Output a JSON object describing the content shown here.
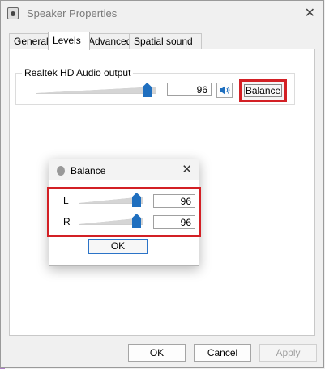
{
  "window": {
    "title": "Speaker Properties",
    "close_glyph": "✕"
  },
  "tabs": [
    {
      "label": "General",
      "active": false
    },
    {
      "label": "Levels",
      "active": true
    },
    {
      "label": "Advanced",
      "active": false
    },
    {
      "label": "Spatial sound",
      "active": false
    }
  ],
  "levels": {
    "group_label": "Realtek HD Audio output",
    "volume_value": "96",
    "volume_level": 0.96,
    "speaker_icon": "speaker-icon",
    "balance_label": "Balance"
  },
  "balance_dialog": {
    "title": "Balance",
    "icon": "speaker-icon",
    "close_glyph": "✕",
    "channels": [
      {
        "label": "L",
        "value": "96",
        "level": 0.96
      },
      {
        "label": "R",
        "value": "96",
        "level": 0.96
      }
    ],
    "ok_label": "OK"
  },
  "footer": {
    "ok_label": "OK",
    "cancel_label": "Cancel",
    "apply_label": "Apply",
    "apply_enabled": false
  },
  "colors": {
    "accent": "#1f6fbf",
    "highlight": "#d32025"
  }
}
